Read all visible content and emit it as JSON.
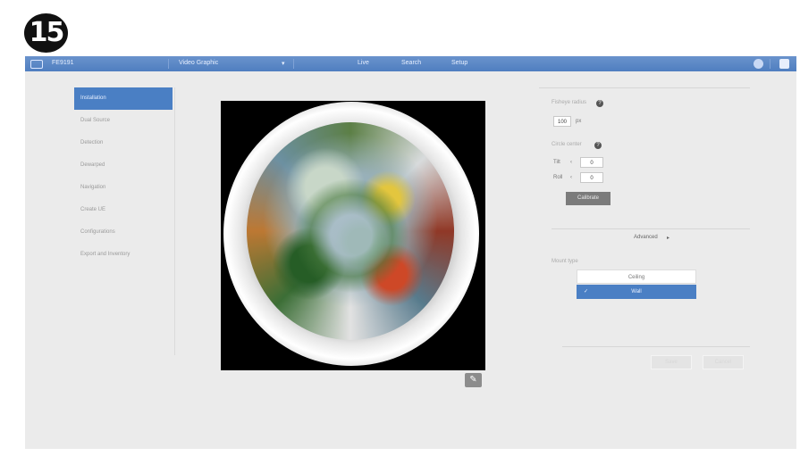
{
  "step_badge": "15",
  "topbar": {
    "device_name": "FE9191",
    "menu_label": "Video Graphic",
    "menu_arrow": "▾",
    "nav": [
      "Live",
      "Search",
      "Setup"
    ]
  },
  "sidebar": {
    "items": [
      {
        "label": "Installation",
        "active": true
      },
      {
        "label": "Dual Source",
        "active": false
      },
      {
        "label": "Detection",
        "active": false
      },
      {
        "label": "Dewarped",
        "active": false
      },
      {
        "label": "Navigation",
        "active": false
      },
      {
        "label": "Create UE",
        "active": false
      },
      {
        "label": "Configurations",
        "active": false
      },
      {
        "label": "Export and Inventory",
        "active": false
      }
    ]
  },
  "settings": {
    "radius_label": "Fisheye radius",
    "radius_value": "100",
    "radius_unit": "px",
    "center_label": "Circle center",
    "tilt_label": "Tilt",
    "tilt_value": "0",
    "roll_label": "Roll",
    "roll_value": "0",
    "calibrate_label": "Calibrate",
    "advanced_label": "Advanced",
    "advanced_arrow": "▸",
    "mount_label": "Mount type",
    "mount_options": [
      {
        "label": "Ceiling",
        "selected": false
      },
      {
        "label": "Wall",
        "selected": true
      }
    ],
    "save_label": "Save",
    "cancel_label": "Cancel"
  },
  "icons": {
    "logo": "camera-logo-icon",
    "help": "help-icon",
    "edit": "pencil-icon",
    "user": "user-icon",
    "settings": "gear-icon"
  },
  "colors": {
    "accent": "#4a7fc4",
    "topbar": "#5b88c6",
    "frame_bg": "#ebebeb"
  }
}
